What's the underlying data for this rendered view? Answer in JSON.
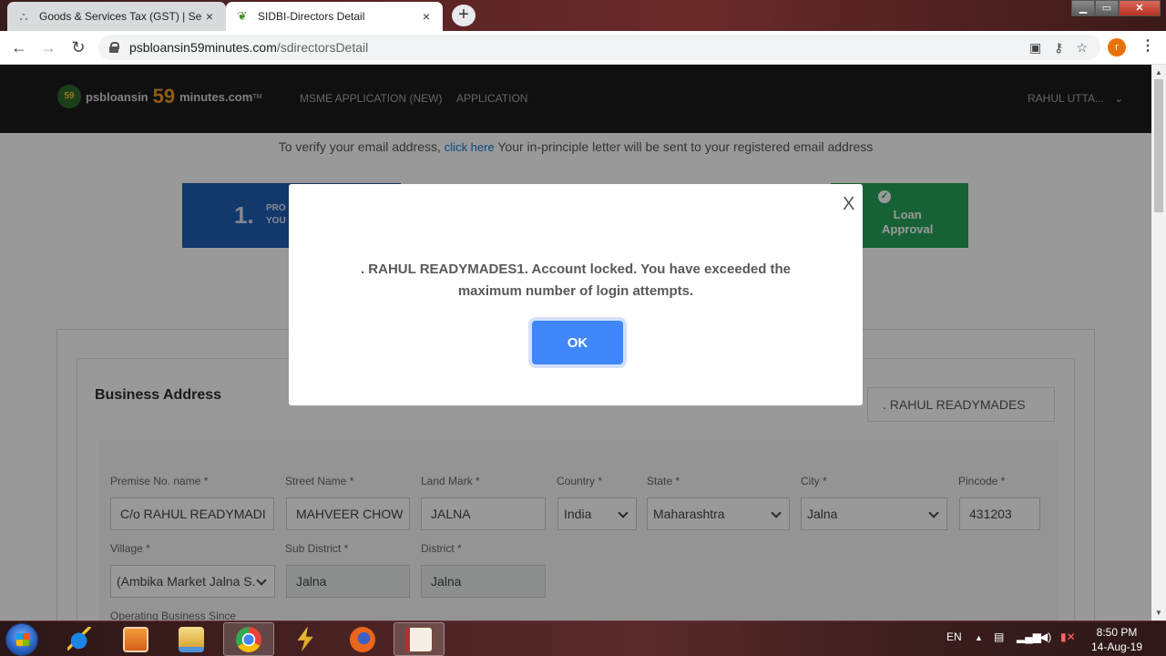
{
  "browser": {
    "tabs": [
      {
        "title": "Goods & Services Tax (GST) | Ser",
        "close": "×"
      },
      {
        "title": "SIDBI-Directors Detail",
        "close": "×"
      }
    ],
    "new_tab": "+",
    "url_host": "psbloansin59minutes.com",
    "url_path": "/sdirectorsDetail",
    "profile_initial": "r"
  },
  "site": {
    "logo": {
      "prefix": "psbloansin",
      "number": "59",
      "suffix": "minutes.com",
      "tm": "TM",
      "emblem": "59"
    },
    "nav": [
      {
        "label": "MSME APPLICATION (NEW)"
      },
      {
        "label": "APPLICATION"
      }
    ],
    "user": "RAHUL UTTA...",
    "verify_prefix": "To verify your email address, ",
    "verify_link": "click here",
    "verify_suffix": " Your in-principle letter will be sent to your registered email address",
    "steps": [
      {
        "number": "1.",
        "label_line1": "PRO",
        "label_line2": "YOU"
      },
      {
        "label_line1": "Loan",
        "label_line2": "Approval"
      }
    ]
  },
  "form": {
    "section_title": "Business Address",
    "company_name": ". RAHUL READYMADES",
    "fields": [
      {
        "label": "Premise No. name *",
        "value": "C/o RAHUL READYMADI"
      },
      {
        "label": "Street Name *",
        "value": "MAHVEER CHOW"
      },
      {
        "label": "Land Mark *",
        "value": "JALNA"
      },
      {
        "label": "Country *",
        "value": "India"
      },
      {
        "label": "State *",
        "value": "Maharashtra"
      },
      {
        "label": "City *",
        "value": "Jalna"
      },
      {
        "label": "Pincode *",
        "value": "431203"
      },
      {
        "label": "Village *",
        "value": "(Ambika Market Jalna S."
      },
      {
        "label": "Sub District *",
        "value": "Jalna"
      },
      {
        "label": "District *",
        "value": "Jalna"
      },
      {
        "label": "Operating Business Since",
        "value": ""
      }
    ]
  },
  "modal": {
    "close": "X",
    "message": ". RAHUL READYMADES1. Account locked. You have exceeded the maximum number of login attempts.",
    "ok_label": "OK"
  },
  "taskbar": {
    "language": "EN",
    "time": "8:50 PM",
    "date": "14-Aug-19",
    "apps": [
      "ie-icon",
      "media-player-icon",
      "file-explorer-icon",
      "chrome-icon",
      "winamp-icon",
      "firefox-icon",
      "tally-erp-icon"
    ]
  },
  "colors": {
    "ok_button": "#3f87fb",
    "step1": "#1e5eb5",
    "step5": "#26a35a",
    "logo_number": "#ea9b22"
  }
}
